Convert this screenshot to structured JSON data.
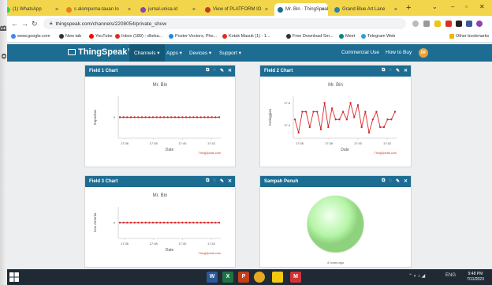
{
  "browser": {
    "tabs": [
      {
        "label": "(1) WhatsApp",
        "color": "#25d366",
        "active": false
      },
      {
        "label": "s alompurna-tauan Io",
        "color": "#e67e22",
        "active": false
      },
      {
        "label": "jurnal.unisa.id",
        "color": "#8e44ad",
        "active": false
      },
      {
        "label": "View of PLATFORM IO",
        "color": "#c0392b",
        "active": false
      },
      {
        "label": "Mr. Bin · ThingSpeak",
        "color": "#1d6c91",
        "active": true
      },
      {
        "label": "Grand Blue Art Lane",
        "color": "#2980b9",
        "active": false
      }
    ],
    "url": "thingspeak.com/channels/2208054/private_show",
    "bookmarks": [
      {
        "label": "www.google.com",
        "color": "#4285f4"
      },
      {
        "label": "New tab",
        "color": "#333333"
      },
      {
        "label": "YouTube",
        "color": "#ff0000"
      },
      {
        "label": "Inbox (189) - dheka...",
        "color": "#d93025"
      },
      {
        "label": "Poster Vectors, Pho...",
        "color": "#1e88e5"
      },
      {
        "label": "Kotak Masuk (1) - 1...",
        "color": "#d93025"
      },
      {
        "label": "Free Download Sm...",
        "color": "#333333"
      },
      {
        "label": "Meet",
        "color": "#00897b"
      },
      {
        "label": "Telegram Web",
        "color": "#2aa1da"
      }
    ],
    "other_bookmarks": "Other bookmarks"
  },
  "ts_nav": {
    "logo": "ThingSpeak™",
    "links": [
      "Channels ▾",
      "Apps ▾",
      "Devices ▾",
      "Support ▾"
    ],
    "right_links": [
      "Commercial Use",
      "How to Buy"
    ],
    "avatar": "DF"
  },
  "cards": [
    {
      "title": "Field 1 Chart",
      "chart_title": "Mr. Bin",
      "ylabel": "Kapasitas",
      "xlabel": "Date",
      "credit": "ThingSpeak.com",
      "chart_data": {
        "type": "line",
        "x": [
          "17:36",
          "17:38",
          "17:40",
          "17:42"
        ],
        "yticks": [
          "0"
        ],
        "values": [
          0,
          0,
          0,
          0,
          0,
          0,
          0,
          0,
          0,
          0,
          0,
          0,
          0,
          0,
          0,
          0,
          0,
          0,
          0,
          0,
          0,
          0,
          0,
          0,
          0,
          0,
          0,
          0
        ]
      }
    },
    {
      "title": "Field 2 Chart",
      "chart_title": "Mr. Bin",
      "ylabel": "Ketinggian",
      "xlabel": "Date",
      "credit": "ThingSpeak.com",
      "chart_data": {
        "type": "line",
        "x": [
          "17:36",
          "17:38",
          "17:40",
          "17:42"
        ],
        "yticks": [
          "17.6",
          "17.4"
        ],
        "ylim": [
          17.28,
          17.66
        ],
        "values": [
          17.45,
          17.33,
          17.52,
          17.52,
          17.38,
          17.52,
          17.52,
          17.36,
          17.6,
          17.38,
          17.55,
          17.45,
          17.45,
          17.52,
          17.45,
          17.6,
          17.47,
          17.58,
          17.38,
          17.52,
          17.33,
          17.45,
          17.52,
          17.38,
          17.38,
          17.45,
          17.45,
          17.52
        ]
      }
    },
    {
      "title": "Field 3 Chart",
      "chart_title": "Mr. Bin",
      "ylabel": "Gas Amonia",
      "xlabel": "Date",
      "credit": "ThingSpeak.com",
      "chart_data": {
        "type": "line",
        "x": [
          "17:36",
          "17:38",
          "17:40",
          "17:42"
        ],
        "yticks": [
          "0"
        ],
        "values": [
          0,
          0,
          0,
          0,
          0,
          0,
          0,
          0,
          0,
          0,
          0,
          0,
          0,
          0,
          0,
          0,
          0,
          0,
          0,
          0,
          0,
          0,
          0,
          0,
          0,
          0,
          0,
          0
        ]
      }
    },
    {
      "title": "Sampah Penuh",
      "lamp_color": "#b5f5a6",
      "caption": "4 hours ago"
    }
  ],
  "taskbar": {
    "apps": [
      {
        "label": "W",
        "color": "#2b5797"
      },
      {
        "label": "X",
        "color": "#1f7244"
      },
      {
        "label": "P",
        "color": "#c43e1c"
      },
      {
        "label": "",
        "color": "#e7a922"
      },
      {
        "label": "",
        "color": "#f2c811"
      },
      {
        "label": "M",
        "color": "#d13438"
      }
    ],
    "tray_lang": "ENG",
    "time": "9:48 PM",
    "date": "7/11/2023"
  }
}
